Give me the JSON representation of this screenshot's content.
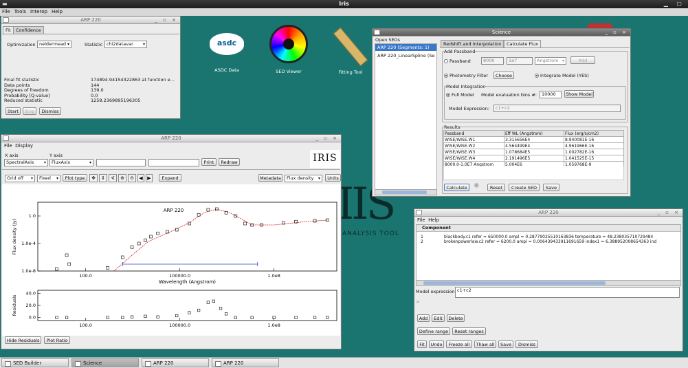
{
  "app": {
    "title": "Iris",
    "menu": [
      "File",
      "Tools",
      "Interop",
      "Help"
    ]
  },
  "desktop": {
    "icons": [
      {
        "label": "ASDC Data",
        "logo": "asdc"
      },
      {
        "label": "SED Viewer"
      },
      {
        "label": "Fitting Tool"
      }
    ],
    "bg_logo_text": "ANALYSIS TOOL"
  },
  "fit_window": {
    "title": "ARP 220",
    "tabs": [
      "Fit",
      "Confidence"
    ],
    "optimization_label": "Optimization",
    "optimization_value": "neldermead",
    "statistic_label": "Statistic",
    "statistic_value": "chi2datavar",
    "results": [
      {
        "label": "Final fit statistic",
        "value": "174894.94154322863  at function e..."
      },
      {
        "label": "Data points",
        "value": "144"
      },
      {
        "label": "Degrees of freedom",
        "value": "139.0"
      },
      {
        "label": "Probability [Q-value]",
        "value": "0.0"
      },
      {
        "label": "Reduced statistic",
        "value": "1258.2369895196305"
      }
    ],
    "buttons": {
      "start": "Start",
      "stop": "Stop",
      "dismiss": "Dismiss"
    }
  },
  "plot_window": {
    "title": "ARP 220",
    "menu": [
      "File",
      "Display"
    ],
    "xaxis_label": "X axis",
    "yaxis_label": "Y axis",
    "xaxis_value": "SpectralAxis",
    "yaxis_value": "FluxAxis",
    "print": "Print",
    "redraw": "Redraw",
    "grid": "Grid off",
    "scale": "Fixed",
    "plot_type": "Plot type",
    "expand": "Expand",
    "metadata": "Metadata",
    "flux_density": "Flux density",
    "units": "Units",
    "hide_residuals": "Hide Residuals",
    "plot_ratio": "Plot Ratio",
    "logo": "IRIS"
  },
  "science_window": {
    "title": "Science",
    "open_seds_label": "Open SEDs",
    "seds": [
      "ARP 220 (Segments: 1)",
      "ARP 220_LinearSpline (Se"
    ],
    "tabs": [
      "Redshift and Interpolation",
      "Calculate Flux"
    ],
    "add_passband": "Add Passband",
    "passband_label": "Passband",
    "passband_min": "8000",
    "passband_max": "1e7",
    "passband_unit": "Angstrom",
    "add": "Add",
    "photometry_filter": "Photometry Filter",
    "choose": "Choose",
    "integrate_model": "Integrate Model (YES)",
    "model_integration": "Model Integration",
    "full_model": "Full Model",
    "eval_bins_label": "Model evaluation bins #:",
    "eval_bins": "10000",
    "show_model": "Show Model",
    "model_expression_label": "Model Expression:",
    "model_expression": "c1+c2",
    "results_label": "Results",
    "columns": [
      "Passband",
      "Eff WL (Angstrom)",
      "Flux (erg/s/cm2)"
    ],
    "rows": [
      [
        "WISE/WISE.W1",
        "3.315656E4",
        "8.940081E-16"
      ],
      [
        "WISE/WISE.W2",
        "4.564499E4",
        "4.961966E-16"
      ],
      [
        "WISE/WISE.W3",
        "1.078684E5",
        "1.002782E-16"
      ],
      [
        "WISE/WISE.W4",
        "2.191496E5",
        "1.041525E-15"
      ],
      [
        "8000.0-1.0E7 Angstrom",
        "5.004E6",
        "1.059768E-9"
      ]
    ],
    "buttons": {
      "calculate": "Calculate",
      "reset": "Reset",
      "create_sed": "Create SED",
      "save": "Save"
    }
  },
  "model_window": {
    "title": "ARP 220",
    "menu": [
      "File",
      "Help"
    ],
    "component_header": "Component",
    "components": [
      {
        "id": "1",
        "text": "blackbody.c1   refer = 650000.0 ampl = 0.28779025510163836 temperature = 48.238035710729484"
      },
      {
        "id": "2",
        "text": "brokenpowerlaw.c2   refer = 6200.0 ampl = 0.006439433911691659 index1 = 6.388952008654363 ind"
      }
    ],
    "prompt": ">",
    "model_expression_label": "Model expression:",
    "model_expression": "c1+c2",
    "buttons": {
      "add": "Add",
      "edit": "Edit",
      "delete": "Delete",
      "define_range": "Define range",
      "reset_ranges": "Reset ranges",
      "fit": "Fit",
      "undo": "Undo",
      "freeze_all": "Freeze all",
      "thaw_all": "Thaw all",
      "save": "Save",
      "dismiss": "Dismiss"
    }
  },
  "taskbar": [
    "SED Builder",
    "Science",
    "ARP 220",
    "ARP 220"
  ],
  "chart_data": {
    "type": "scatter",
    "title": "ARP 220",
    "xlabel": "Wavelength (Angstrom)",
    "ylabel": "Flux density (Jy)",
    "residuals_ylabel": "Residuals",
    "x_scale": "log",
    "y_scale": "log",
    "x_ticks": [
      "100.0",
      "100000.0",
      "1.0e8"
    ],
    "y_ticks": [
      "1.0e-8",
      "1.0e-4",
      "1.0"
    ],
    "residual_ticks": [
      "0.0",
      "20.0",
      "40.0"
    ],
    "xlim": [
      3,
      10000000000.0
    ],
    "ylim": [
      1e-08,
      100
    ],
    "residual_ylim": [
      -5,
      45
    ],
    "data_points": [
      [
        12,
        2e-08
      ],
      [
        25,
        2e-06
      ],
      [
        30,
        1e-07
      ],
      [
        500,
        3e-08
      ],
      [
        1500,
        1e-06
      ],
      [
        3000,
        3e-05
      ],
      [
        5000,
        0.0001
      ],
      [
        8000,
        0.0003
      ],
      [
        12000,
        0.001
      ],
      [
        20000,
        0.003
      ],
      [
        40000,
        0.005
      ],
      [
        80000,
        0.01
      ],
      [
        200000,
        0.08
      ],
      [
        400000,
        1.5
      ],
      [
        800000,
        8
      ],
      [
        1500000,
        10
      ],
      [
        3000000,
        3
      ],
      [
        6000000,
        1
      ],
      [
        12000000,
        0.08
      ],
      [
        20000000,
        0.05
      ],
      [
        40000000,
        0.05
      ],
      [
        200000000,
        0.1
      ],
      [
        500000000,
        0.15
      ],
      [
        2000000000,
        0.2
      ],
      [
        5000000000,
        0.25
      ]
    ],
    "model_line": [
      [
        800,
        1e-08
      ],
      [
        3000,
        2e-06
      ],
      [
        10000,
        0.0002
      ],
      [
        50000,
        0.005
      ],
      [
        200000,
        0.1
      ],
      [
        600000,
        3
      ],
      [
        1500000,
        10
      ],
      [
        4000000,
        3
      ],
      [
        10000000,
        0.3
      ],
      [
        20000000,
        0.05
      ],
      [
        100000000,
        0.05
      ],
      [
        1000000000,
        0.15
      ],
      [
        5000000000,
        0.25
      ]
    ],
    "residuals": [
      [
        12,
        0
      ],
      [
        25,
        0
      ],
      [
        500,
        0
      ],
      [
        1500,
        0
      ],
      [
        3000,
        1
      ],
      [
        8000,
        2
      ],
      [
        20000,
        1
      ],
      [
        80000,
        3
      ],
      [
        200000,
        8
      ],
      [
        400000,
        12
      ],
      [
        800000,
        25
      ],
      [
        1200000,
        27
      ],
      [
        2000000,
        15
      ],
      [
        3000000,
        6
      ],
      [
        6000000,
        0
      ],
      [
        20000000,
        0
      ],
      [
        100000000,
        0
      ],
      [
        500000000,
        0
      ],
      [
        2000000000,
        0
      ],
      [
        5000000000,
        0
      ]
    ],
    "range_marker": [
      1500,
      30000000
    ]
  }
}
